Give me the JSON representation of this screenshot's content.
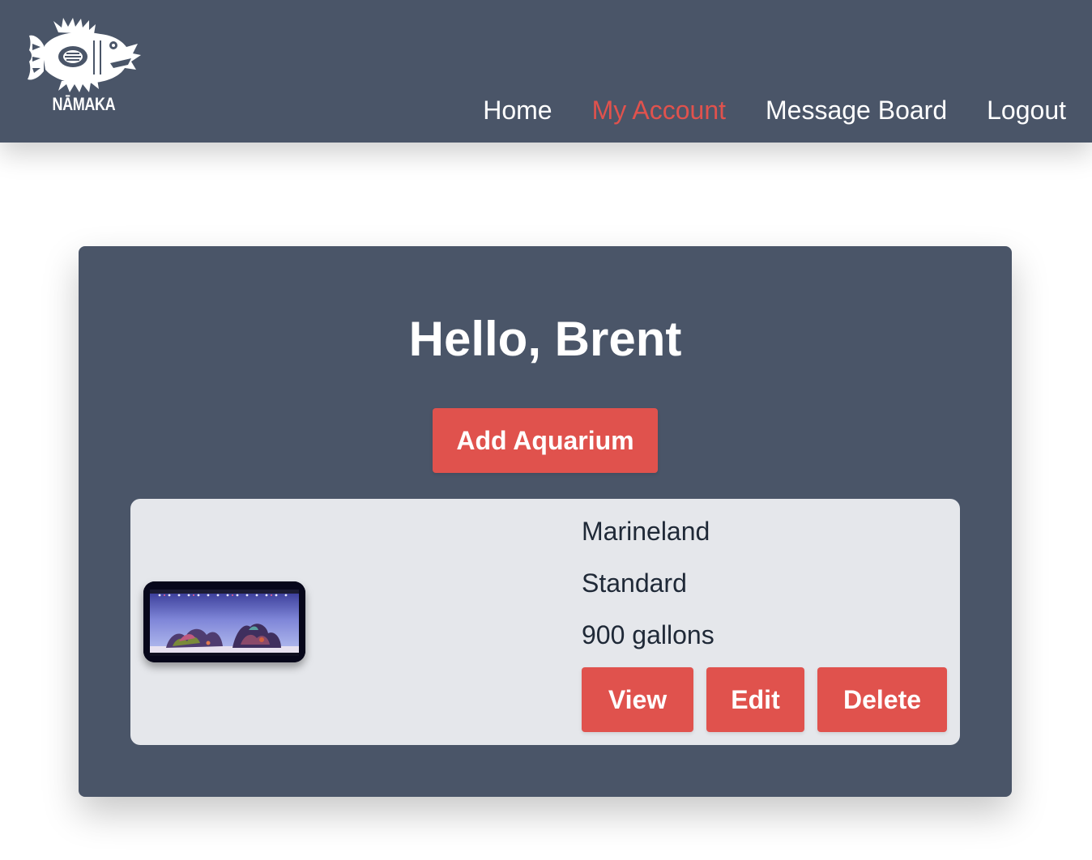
{
  "brand": {
    "logo_text": "NĀMAKA",
    "logo_icon": "fish-glyph-icon"
  },
  "nav": {
    "items": [
      {
        "label": "Home",
        "active": false
      },
      {
        "label": "My Account",
        "active": true
      },
      {
        "label": "Message Board",
        "active": false
      },
      {
        "label": "Logout",
        "active": false
      }
    ]
  },
  "account": {
    "greeting": "Hello, Brent",
    "add_button_label": "Add Aquarium"
  },
  "aquariums": [
    {
      "brand": "Marineland",
      "type": "Standard",
      "volume": "900 gallons",
      "view_label": "View",
      "edit_label": "Edit",
      "delete_label": "Delete"
    }
  ],
  "colors": {
    "nav_background": "#4a5568",
    "accent": "#e0524d",
    "tank_card_background": "#e5e7eb"
  }
}
